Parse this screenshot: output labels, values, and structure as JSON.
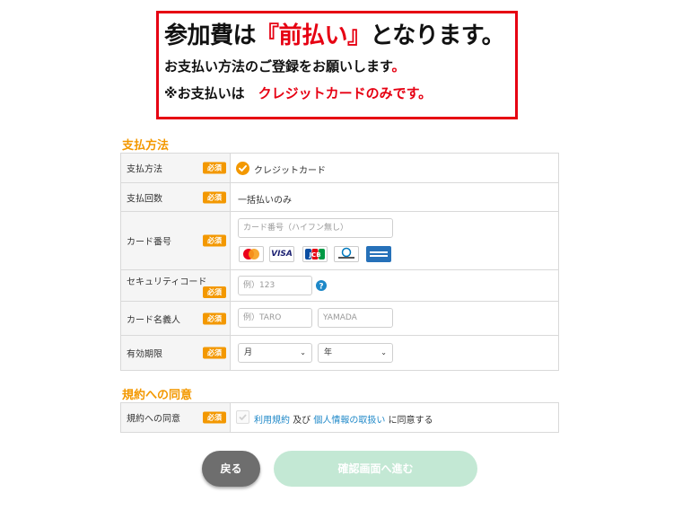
{
  "notice": {
    "line1_a": "参加費は",
    "line1_b": "『前払い』",
    "line1_c": "となります。",
    "line2_a": "お支払い方法のご登録をお願いします",
    "line2_b": "。",
    "line3_a": "※お支払いは　",
    "line3_b": "クレジットカードのみです。"
  },
  "payment_section": {
    "title": "支払方法",
    "required_label": "必須",
    "method": {
      "label": "支払方法",
      "value": "クレジットカード"
    },
    "installments": {
      "label": "支払回数",
      "value": "一括払いのみ"
    },
    "card_number": {
      "label": "カード番号",
      "placeholder": "カード番号（ハイフン無し）"
    },
    "card_brands": [
      "MasterCard",
      "VISA",
      "JCB",
      "Diners Club",
      "AMERICAN EXPRESS"
    ],
    "security_code": {
      "label": "セキュリティコード",
      "placeholder": "例）123"
    },
    "card_holder": {
      "label": "カード名義人",
      "first_placeholder": "例）TARO",
      "last_placeholder": "YAMADA"
    },
    "expiry": {
      "label": "有効期限",
      "month": "月",
      "year": "年"
    }
  },
  "terms_section": {
    "title": "規約への同意",
    "label": "規約への同意",
    "terms_link": "利用規約",
    "and_text": "及び",
    "privacy_link": "個人情報の取扱い",
    "agree_text": "に同意する"
  },
  "buttons": {
    "back": "戻る",
    "next": "確認画面へ進む"
  },
  "colors": {
    "accent": "#f39800",
    "alert": "#e60012",
    "next_button_disabled": "#c3e8d4"
  }
}
